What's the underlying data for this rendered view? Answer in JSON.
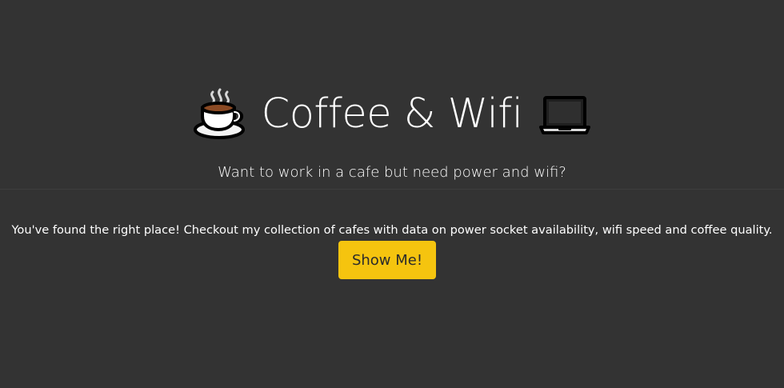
{
  "header": {
    "title": "Coffee & Wifi",
    "subtitle": "Want to work in a cafe but need power and wifi?",
    "left_icon": "coffee-cup-icon",
    "right_icon": "laptop-icon"
  },
  "main": {
    "intro_text": "You've found the right place! Checkout my collection of cafes with data on power socket availability, wifi speed and coffee quality.",
    "cta_label": "Show Me!"
  },
  "colors": {
    "background": "#333333",
    "text": "#ffffff",
    "button": "#f5c40f",
    "button_text": "#2b2b2b"
  }
}
